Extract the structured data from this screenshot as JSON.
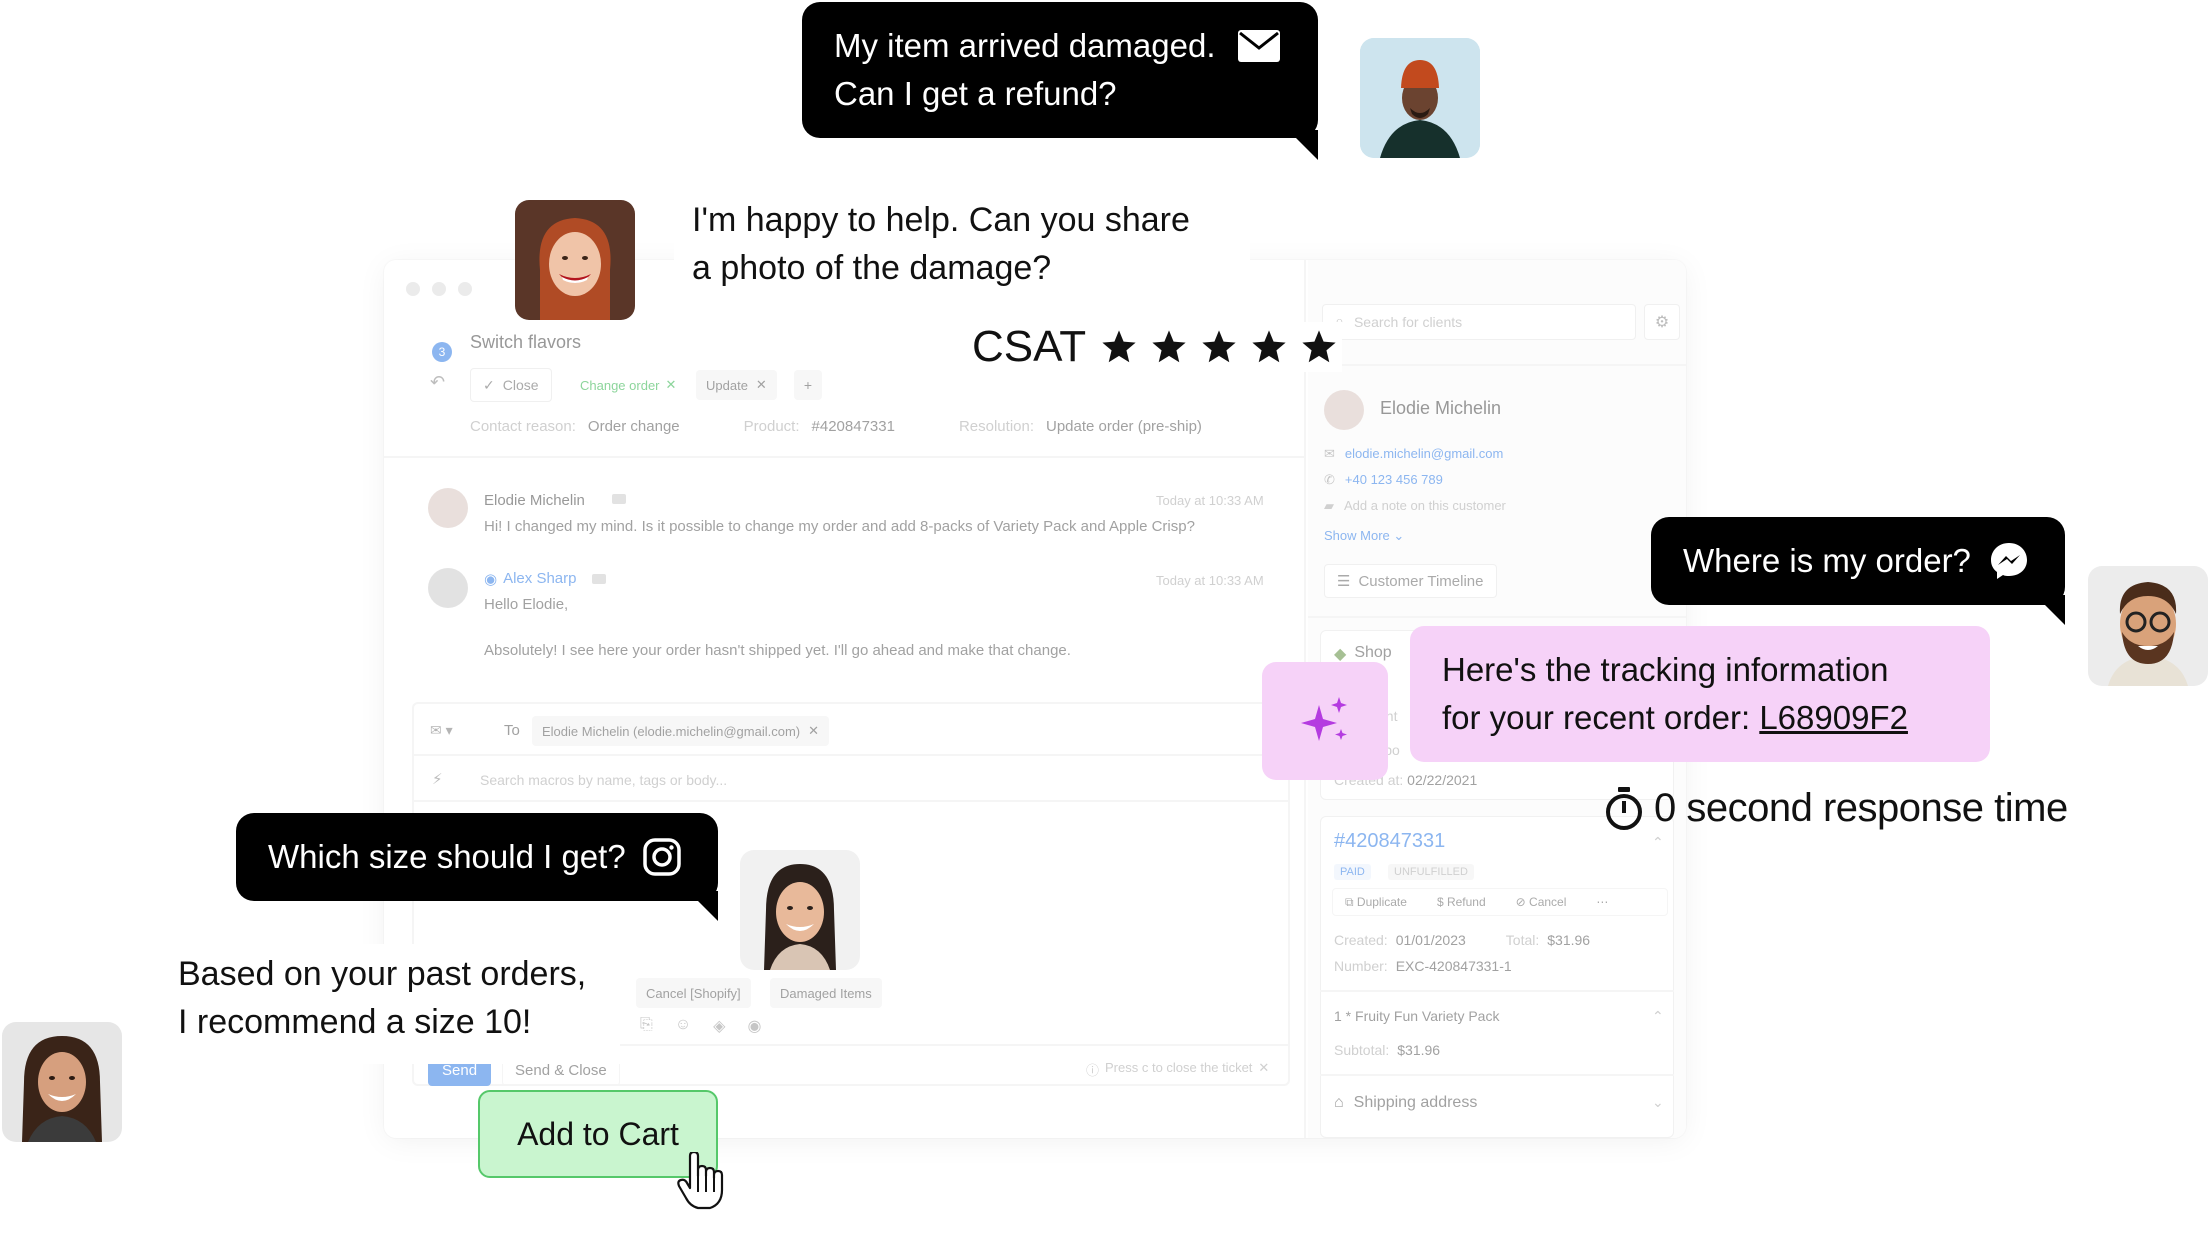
{
  "customer_messages": {
    "damaged": "My item arrived damaged.\nCan I get a refund?",
    "order": "Where is my order?",
    "size": "Which size should I get?"
  },
  "agent_replies": {
    "photo_request_line1": "I'm happy to help. Can you share",
    "photo_request_line2": "a photo of the damage?",
    "tracking_line1": "Here's the tracking information",
    "tracking_line2_prefix": "for your recent order: ",
    "tracking_number": "L68909F2",
    "size_line1": "Based on your past orders,",
    "size_line2": "I recommend a size 10!"
  },
  "csat": {
    "label": "CSAT",
    "stars": 5
  },
  "response_time": "0 second response time",
  "add_to_cart": "Add to Cart",
  "colors": {
    "pink": "#f6d2f8",
    "green_bg": "#c9f5cf",
    "green_border": "#55c86a",
    "accent_blue": "#2f7be5"
  },
  "ticket": {
    "badge": "3",
    "title": "Switch flavors",
    "close_label": "Close",
    "tag_change_order": "Change order",
    "tag_update": "Update",
    "add_label": "+",
    "contact_reason_label": "Contact reason:",
    "contact_reason_value": "Order change",
    "product_label": "Product:",
    "product_value": "#420847331",
    "resolution_label": "Resolution:",
    "resolution_value": "Update order (pre-ship)",
    "messages": [
      {
        "author": "Elodie Michelin",
        "time": "Today at 10:33 AM",
        "body": "Hi! I changed my mind. Is it possible to change my order and add 8-packs of Variety Pack and Apple Crisp?"
      },
      {
        "author": "Alex Sharp",
        "time": "Today at 10:33 AM",
        "body": "Hello Elodie,",
        "body2": "Absolutely! I see here your order hasn't shipped yet. I'll go ahead and make that change."
      }
    ],
    "to_label": "To",
    "to_value": "Elodie Michelin (elodie.michelin@gmail.com)",
    "macro_placeholder": "Search macros by name, tags or body...",
    "macro_tags": [
      "Cancel [Shopify]",
      "Damaged Items"
    ],
    "send": "Send",
    "send_close": "Send & Close",
    "hint": "Press c to close the ticket"
  },
  "customer_panel": {
    "search_placeholder": "Search for clients",
    "name": "Elodie Michelin",
    "email": "elodie.michelin@gmail.com",
    "phone": "+40 123 456 789",
    "note_placeholder": "Add a note on this customer",
    "show_more": "Show More",
    "timeline": "Customer Timeline",
    "shopify_label": "Shop",
    "spent_fragment": "ent",
    "clipo_fragment": "lipo",
    "created_at_prefix": "Created at: ",
    "created_at_value": "02/22/2021",
    "order_number": "#420847331",
    "status_paid": "PAID",
    "status_unfulfilled": "UNFULFILLED",
    "actions": [
      "Duplicate",
      "Refund",
      "Cancel"
    ],
    "created_label": "Created:",
    "created_value": "01/01/2023",
    "total_label": "Total:",
    "total_value": "$31.96",
    "number_label": "Number:",
    "number_value": "EXC-420847331-1",
    "item": "1 * Fruity Fun Variety Pack",
    "subtotal_label": "Subtotal:",
    "subtotal_value": "$31.96",
    "shipping": "Shipping address"
  }
}
